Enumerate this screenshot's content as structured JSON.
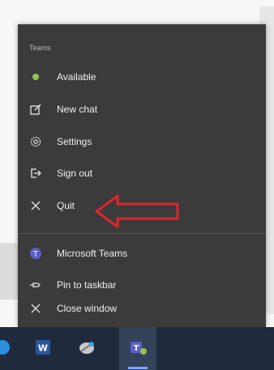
{
  "menu": {
    "section_title": "Teams",
    "items": [
      {
        "label": "Available",
        "icon": "status-available-icon"
      },
      {
        "label": "New chat",
        "icon": "new-chat-icon"
      },
      {
        "label": "Settings",
        "icon": "gear-icon"
      },
      {
        "label": "Sign out",
        "icon": "sign-out-icon"
      },
      {
        "label": "Quit",
        "icon": "close-icon"
      }
    ],
    "bottom_items": [
      {
        "label": "Microsoft Teams",
        "icon": "teams-icon"
      },
      {
        "label": "Pin to taskbar",
        "icon": "pin-icon"
      },
      {
        "label": "Close window",
        "icon": "close-icon"
      }
    ]
  },
  "colors": {
    "menu_bg": "#3b3b3b",
    "available": "#92c353",
    "annotation_arrow": "#e0242b",
    "taskbar_bg": "#1f2a3c"
  },
  "taskbar": {
    "icons": [
      "partial-icon",
      "word-icon",
      "snip-icon",
      "teams-icon"
    ]
  }
}
